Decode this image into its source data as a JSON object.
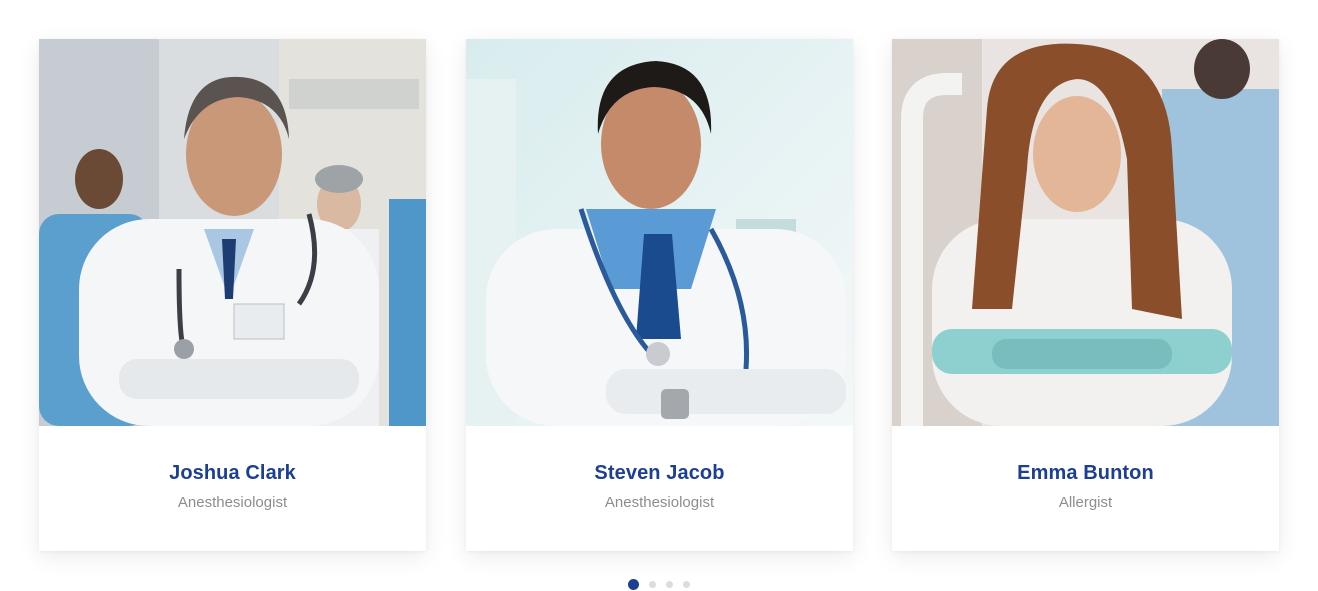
{
  "doctors": [
    {
      "name": "Joshua Clark",
      "role": "Anesthesiologist",
      "photo": "doctor-portrait-male-grey-hair"
    },
    {
      "name": "Steven Jacob",
      "role": "Anesthesiologist",
      "photo": "doctor-portrait-male-dark-hair"
    },
    {
      "name": "Emma Bunton",
      "role": "Allergist",
      "photo": "doctor-portrait-female-long-hair"
    }
  ],
  "pagination": {
    "pages": 4,
    "active_index": 0
  },
  "colors": {
    "accent": "#1c3f94",
    "role_text": "#8d8d8d",
    "dot_inactive": "#dcdcdc"
  }
}
